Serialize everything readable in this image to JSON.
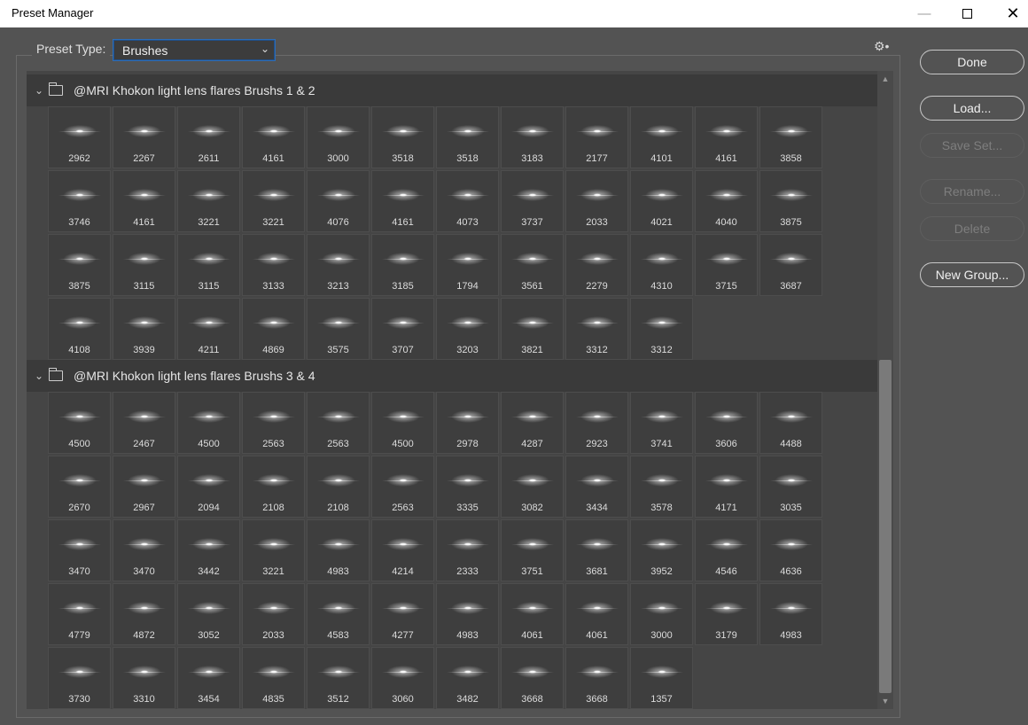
{
  "window": {
    "title": "Preset Manager"
  },
  "preset_type": {
    "label": "Preset Type:",
    "value": "Brushes"
  },
  "buttons": {
    "done": "Done",
    "load": "Load...",
    "save_set": "Save Set...",
    "rename": "Rename...",
    "delete": "Delete",
    "new_group": "New Group..."
  },
  "groups": [
    {
      "name": "@MRI Khokon light lens flares Brushs 1 & 2",
      "items": [
        "2962",
        "2267",
        "2611",
        "4161",
        "3000",
        "3518",
        "3518",
        "3183",
        "2177",
        "4101",
        "4161",
        "3858",
        "3746",
        "4161",
        "3221",
        "3221",
        "4076",
        "4161",
        "4073",
        "3737",
        "2033",
        "4021",
        "4040",
        "3875",
        "3875",
        "3115",
        "3115",
        "3133",
        "3213",
        "3185",
        "1794",
        "3561",
        "2279",
        "4310",
        "3715",
        "3687",
        "4108",
        "3939",
        "4211",
        "4869",
        "3575",
        "3707",
        "3203",
        "3821",
        "3312",
        "3312"
      ]
    },
    {
      "name": "@MRI Khokon light lens flares Brushs 3 & 4",
      "items": [
        "4500",
        "2467",
        "4500",
        "2563",
        "2563",
        "4500",
        "2978",
        "4287",
        "2923",
        "3741",
        "3606",
        "4488",
        "2670",
        "2967",
        "2094",
        "2108",
        "2108",
        "2563",
        "3335",
        "3082",
        "3434",
        "3578",
        "4171",
        "3035",
        "3470",
        "3470",
        "3442",
        "3221",
        "4983",
        "4214",
        "2333",
        "3751",
        "3681",
        "3952",
        "4546",
        "4636",
        "4779",
        "4872",
        "3052",
        "2033",
        "4583",
        "4277",
        "4983",
        "4061",
        "4061",
        "3000",
        "3179",
        "4983",
        "3730",
        "3310",
        "3454",
        "4835",
        "3512",
        "3060",
        "3482",
        "3668",
        "3668",
        "1357"
      ]
    }
  ]
}
